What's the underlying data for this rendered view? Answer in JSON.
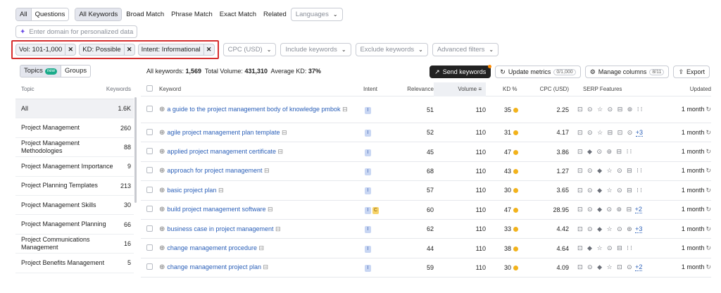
{
  "modes": [
    "All",
    "Questions"
  ],
  "matches": [
    "All Keywords",
    "Broad Match",
    "Phrase Match",
    "Exact Match",
    "Related"
  ],
  "languages": "Languages",
  "domain_placeholder": "Enter domain for personalized data",
  "active_filters": [
    "Vol: 101-1,000",
    "KD: Possible",
    "Intent: Informational"
  ],
  "filter_dropdowns": [
    "CPC (USD)",
    "Include keywords",
    "Exclude keywords",
    "Advanced filters"
  ],
  "sidebar": {
    "tabs": [
      "Topics",
      "Groups"
    ],
    "new_badge": "new",
    "col_topic": "Topic",
    "col_keywords": "Keywords",
    "items": [
      {
        "label": "All",
        "count": "1.6K"
      },
      {
        "label": "Project Management",
        "count": "260"
      },
      {
        "label": "Project Management Methodologies",
        "count": "88"
      },
      {
        "label": "Project Management Importance",
        "count": "9"
      },
      {
        "label": "Project Planning Templates",
        "count": "213"
      },
      {
        "label": "Project Management Skills",
        "count": "30"
      },
      {
        "label": "Project Management Planning",
        "count": "66"
      },
      {
        "label": "Project Communications Management",
        "count": "16"
      },
      {
        "label": "Project Benefits Management",
        "count": "5"
      }
    ]
  },
  "summary": {
    "all_keywords_label": "All keywords:",
    "all_keywords": "1,569",
    "volume_label": "Total Volume:",
    "volume": "431,310",
    "kd_label": "Average KD:",
    "kd": "37%"
  },
  "actions": {
    "send": "Send keywords",
    "update": "Update metrics",
    "update_count": "0/1,000",
    "manage": "Manage columns",
    "manage_count": "8/11",
    "export": "Export"
  },
  "columns": [
    "Keyword",
    "Intent",
    "Relevance",
    "Volume",
    "KD %",
    "CPC (USD)",
    "SERP Features",
    "Updated"
  ],
  "rows": [
    {
      "keyword": "a guide to the project management body of knowledge pmbok",
      "intent": [
        "I"
      ],
      "relevance": "51",
      "volume": "110",
      "kd": "35",
      "cpc": "2.25",
      "serp": "⊡ ⊙ ☆ ⊙ ⊟ ⊚ ⁝⁝",
      "more": "",
      "updated": "1 month"
    },
    {
      "keyword": "agile project management plan template",
      "intent": [
        "I"
      ],
      "relevance": "52",
      "volume": "110",
      "kd": "31",
      "cpc": "4.17",
      "serp": "⊡ ⊙ ☆ ⊟ ⊡ ⊙",
      "more": "+3",
      "updated": "1 month"
    },
    {
      "keyword": "applied project management certificate",
      "intent": [
        "I"
      ],
      "relevance": "45",
      "volume": "110",
      "kd": "47",
      "cpc": "3.86",
      "serp": "⊡ ◆ ⊙ ⊚ ⊟ ⁝⁝",
      "more": "",
      "updated": "1 month"
    },
    {
      "keyword": "approach for project management",
      "intent": [
        "I"
      ],
      "relevance": "68",
      "volume": "110",
      "kd": "43",
      "cpc": "1.27",
      "serp": "⊡ ⊙ ◆ ☆ ⊙ ⊟ ⁝⁝",
      "more": "",
      "updated": "1 month"
    },
    {
      "keyword": "basic project plan",
      "intent": [
        "I"
      ],
      "relevance": "57",
      "volume": "110",
      "kd": "30",
      "cpc": "3.65",
      "serp": "⊡ ⊙ ◆ ☆ ⊙ ⊟ ⁝⁝",
      "more": "",
      "updated": "1 month"
    },
    {
      "keyword": "build project management software",
      "intent": [
        "I",
        "C"
      ],
      "relevance": "60",
      "volume": "110",
      "kd": "47",
      "cpc": "28.95",
      "serp": "⊡ ⊙ ◆ ⊙ ⊚ ⊟",
      "more": "+2",
      "updated": "1 month"
    },
    {
      "keyword": "business case in project management",
      "intent": [
        "I"
      ],
      "relevance": "62",
      "volume": "110",
      "kd": "33",
      "cpc": "4.42",
      "serp": "⊡ ⊙ ◆ ☆ ⊙ ⊚",
      "more": "+3",
      "updated": "1 month"
    },
    {
      "keyword": "change management procedure",
      "intent": [
        "I"
      ],
      "relevance": "44",
      "volume": "110",
      "kd": "38",
      "cpc": "4.64",
      "serp": "⊡ ◆ ☆ ⊙ ⊟ ⁝⁝",
      "more": "",
      "updated": "1 month"
    },
    {
      "keyword": "change management project plan",
      "intent": [
        "I"
      ],
      "relevance": "59",
      "volume": "110",
      "kd": "30",
      "cpc": "4.09",
      "serp": "⊡ ⊙ ◆ ☆ ⊡ ⊙",
      "more": "+2",
      "updated": "1 month"
    }
  ]
}
